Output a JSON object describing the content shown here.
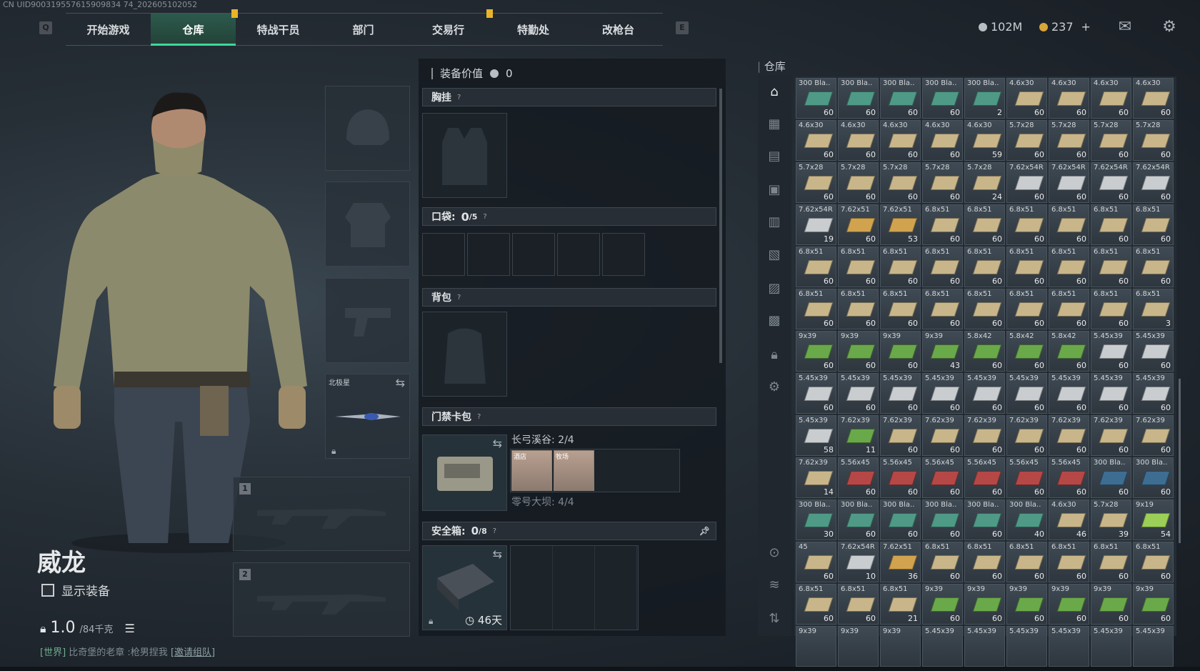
{
  "uid_text": "CN UID900319557615909834 74_202605102052",
  "nav": {
    "key_left": "Q",
    "key_right": "E",
    "tabs": [
      "开始游戏",
      "仓库",
      "特战干员",
      "部门",
      "交易行",
      "特勤处",
      "改枪台"
    ]
  },
  "currency": {
    "silver": "102M",
    "gold": "237",
    "plus": "+"
  },
  "colors": {
    "accent": "#3fd69a",
    "notify": "#e8b52a",
    "silver_coin": "#b8bec4",
    "gold_coin": "#d9a43a"
  },
  "character": {
    "name": "威龙",
    "show_equipment": "显示装备",
    "weight": "1.0",
    "weight_max": "/84千克",
    "chat_channel": "[世界]",
    "chat_text": "比奇堡的老章 :枪男捏我",
    "chat_link": "[邀请组队]"
  },
  "slots": {
    "melee_label": "北极星",
    "weapon1_num": "1",
    "weapon2_num": "2"
  },
  "equip": {
    "value_label": "装备价值",
    "value": "0",
    "chest_rig": "胸挂",
    "pocket": "口袋:",
    "pocket_count": "0",
    "pocket_max": "/5",
    "backpack": "背包",
    "keycard": "门禁卡包",
    "key_map1": "长弓溪谷: 2/4",
    "key_map2": "零号大坝: 4/4",
    "card1": "酒店",
    "card2": "牧场",
    "safebox": "安全箱:",
    "safe_count": "0",
    "safe_max": "/8",
    "safe_timer": "46天",
    "help": "?"
  },
  "warehouse": {
    "title": "仓库",
    "rows": [
      [
        [
          "300 Bla..",
          "60",
          "teal"
        ],
        [
          "300 Bla..",
          "60",
          "teal"
        ],
        [
          "300 Bla..",
          "60",
          "teal"
        ],
        [
          "300 Bla..",
          "60",
          "teal"
        ],
        [
          "300 Bla..",
          "2",
          "teal"
        ],
        [
          "4.6x30",
          "60",
          "tan"
        ],
        [
          "4.6x30",
          "60",
          "tan"
        ],
        [
          "4.6x30",
          "60",
          "tan"
        ],
        [
          "4.6x30",
          "60",
          "tan"
        ]
      ],
      [
        [
          "4.6x30",
          "60",
          "tan"
        ],
        [
          "4.6x30",
          "60",
          "tan"
        ],
        [
          "4.6x30",
          "60",
          "tan"
        ],
        [
          "4.6x30",
          "60",
          "tan"
        ],
        [
          "4.6x30",
          "59",
          "tan"
        ],
        [
          "5.7x28",
          "60",
          "tan"
        ],
        [
          "5.7x28",
          "60",
          "tan"
        ],
        [
          "5.7x28",
          "60",
          "tan"
        ],
        [
          "5.7x28",
          "60",
          "tan"
        ]
      ],
      [
        [
          "5.7x28",
          "60",
          "tan"
        ],
        [
          "5.7x28",
          "60",
          "tan"
        ],
        [
          "5.7x28",
          "60",
          "tan"
        ],
        [
          "5.7x28",
          "60",
          "tan"
        ],
        [
          "5.7x28",
          "24",
          "tan"
        ],
        [
          "7.62x54R",
          "60",
          "white"
        ],
        [
          "7.62x54R",
          "60",
          "white"
        ],
        [
          "7.62x54R",
          "60",
          "white"
        ],
        [
          "7.62x54R",
          "60",
          "white"
        ]
      ],
      [
        [
          "7.62x54R",
          "19",
          "white"
        ],
        [
          "7.62x51",
          "60",
          "orange"
        ],
        [
          "7.62x51",
          "53",
          "orange"
        ],
        [
          "6.8x51",
          "60",
          "tan"
        ],
        [
          "6.8x51",
          "60",
          "tan"
        ],
        [
          "6.8x51",
          "60",
          "tan"
        ],
        [
          "6.8x51",
          "60",
          "tan"
        ],
        [
          "6.8x51",
          "60",
          "tan"
        ],
        [
          "6.8x51",
          "60",
          "tan"
        ]
      ],
      [
        [
          "6.8x51",
          "60",
          "tan"
        ],
        [
          "6.8x51",
          "60",
          "tan"
        ],
        [
          "6.8x51",
          "60",
          "tan"
        ],
        [
          "6.8x51",
          "60",
          "tan"
        ],
        [
          "6.8x51",
          "60",
          "tan"
        ],
        [
          "6.8x51",
          "60",
          "tan"
        ],
        [
          "6.8x51",
          "60",
          "tan"
        ],
        [
          "6.8x51",
          "60",
          "tan"
        ],
        [
          "6.8x51",
          "60",
          "tan"
        ]
      ],
      [
        [
          "6.8x51",
          "60",
          "tan"
        ],
        [
          "6.8x51",
          "60",
          "tan"
        ],
        [
          "6.8x51",
          "60",
          "tan"
        ],
        [
          "6.8x51",
          "60",
          "tan"
        ],
        [
          "6.8x51",
          "60",
          "tan"
        ],
        [
          "6.8x51",
          "60",
          "tan"
        ],
        [
          "6.8x51",
          "60",
          "tan"
        ],
        [
          "6.8x51",
          "60",
          "tan"
        ],
        [
          "6.8x51",
          "3",
          "tan"
        ]
      ],
      [
        [
          "9x39",
          "60",
          "green"
        ],
        [
          "9x39",
          "60",
          "green"
        ],
        [
          "9x39",
          "60",
          "green"
        ],
        [
          "9x39",
          "43",
          "green"
        ],
        [
          "5.8x42",
          "60",
          "green"
        ],
        [
          "5.8x42",
          "60",
          "green"
        ],
        [
          "5.8x42",
          "60",
          "green"
        ],
        [
          "5.45x39",
          "60",
          "white"
        ],
        [
          "5.45x39",
          "60",
          "white"
        ]
      ],
      [
        [
          "5.45x39",
          "60",
          "white"
        ],
        [
          "5.45x39",
          "60",
          "white"
        ],
        [
          "5.45x39",
          "60",
          "white"
        ],
        [
          "5.45x39",
          "60",
          "white"
        ],
        [
          "5.45x39",
          "60",
          "white"
        ],
        [
          "5.45x39",
          "60",
          "white"
        ],
        [
          "5.45x39",
          "60",
          "white"
        ],
        [
          "5.45x39",
          "60",
          "white"
        ],
        [
          "5.45x39",
          "60",
          "white"
        ]
      ],
      [
        [
          "5.45x39",
          "58",
          "white"
        ],
        [
          "7.62x39",
          "11",
          "green"
        ],
        [
          "7.62x39",
          "60",
          "tan"
        ],
        [
          "7.62x39",
          "60",
          "tan"
        ],
        [
          "7.62x39",
          "60",
          "tan"
        ],
        [
          "7.62x39",
          "60",
          "tan"
        ],
        [
          "7.62x39",
          "60",
          "tan"
        ],
        [
          "7.62x39",
          "60",
          "tan"
        ],
        [
          "7.62x39",
          "60",
          "tan"
        ]
      ],
      [
        [
          "7.62x39",
          "14",
          "tan"
        ],
        [
          "5.56x45",
          "60",
          "red"
        ],
        [
          "5.56x45",
          "60",
          "red"
        ],
        [
          "5.56x45",
          "60",
          "red"
        ],
        [
          "5.56x45",
          "60",
          "red"
        ],
        [
          "5.56x45",
          "60",
          "red"
        ],
        [
          "5.56x45",
          "60",
          "red"
        ],
        [
          "300 Bla..",
          "60",
          "blue"
        ],
        [
          "300 Bla..",
          "60",
          "blue"
        ]
      ],
      [
        [
          "300 Bla..",
          "30",
          "teal"
        ],
        [
          "300 Bla..",
          "60",
          "teal"
        ],
        [
          "300 Bla..",
          "60",
          "teal"
        ],
        [
          "300 Bla..",
          "60",
          "teal"
        ],
        [
          "300 Bla..",
          "60",
          "teal"
        ],
        [
          "300 Bla..",
          "40",
          "teal"
        ],
        [
          "4.6x30",
          "46",
          "tan"
        ],
        [
          "5.7x28",
          "39",
          "tan"
        ],
        [
          "9x19",
          "54",
          "lime"
        ]
      ],
      [
        [
          "45",
          "60",
          "tan"
        ],
        [
          "7.62x54R",
          "10",
          "white"
        ],
        [
          "7.62x51",
          "36",
          "orange"
        ],
        [
          "6.8x51",
          "60",
          "tan"
        ],
        [
          "6.8x51",
          "60",
          "tan"
        ],
        [
          "6.8x51",
          "60",
          "tan"
        ],
        [
          "6.8x51",
          "60",
          "tan"
        ],
        [
          "6.8x51",
          "60",
          "tan"
        ],
        [
          "6.8x51",
          "60",
          "tan"
        ]
      ],
      [
        [
          "6.8x51",
          "60",
          "tan"
        ],
        [
          "6.8x51",
          "60",
          "tan"
        ],
        [
          "6.8x51",
          "21",
          "tan"
        ],
        [
          "9x39",
          "60",
          "green"
        ],
        [
          "9x39",
          "60",
          "green"
        ],
        [
          "9x39",
          "60",
          "green"
        ],
        [
          "9x39",
          "60",
          "green"
        ],
        [
          "9x39",
          "60",
          "green"
        ],
        [
          "9x39",
          "60",
          "green"
        ]
      ]
    ],
    "partial_row": [
      "9x39",
      "9x39",
      "9x39",
      "5.45x39",
      "5.45x39",
      "5.45x39",
      "5.45x39",
      "5.45x39",
      "5.45x39"
    ],
    "box_colors": {
      "teal": "#4f9a86",
      "tan": "#c8b68a",
      "white": "#c9cdd0",
      "orange": "#d2a34e",
      "green": "#6aa94a",
      "lime": "#9ccf57",
      "red": "#b54846",
      "blue": "#3d6e92"
    }
  }
}
